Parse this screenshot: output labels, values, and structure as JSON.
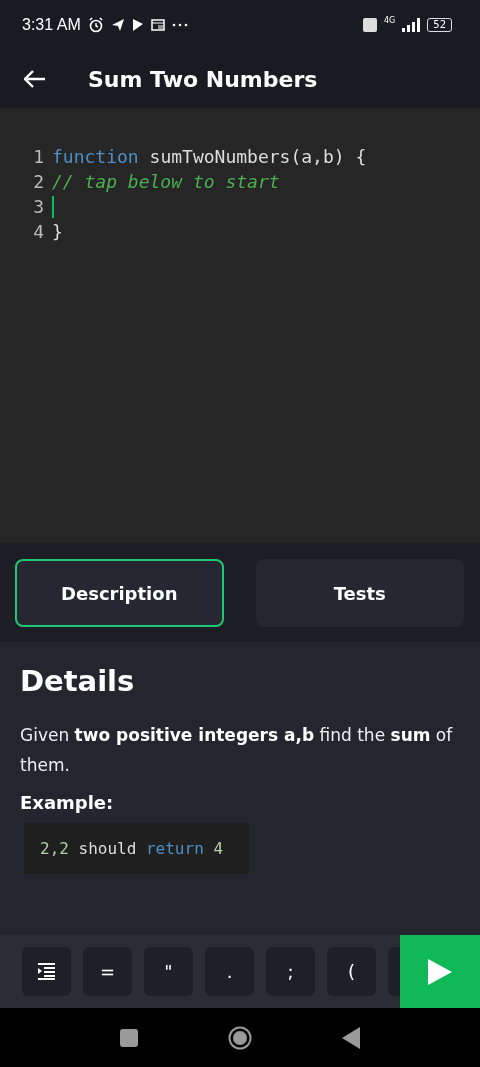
{
  "status_bar": {
    "time": "3:31 AM",
    "network": "4G",
    "battery": "52"
  },
  "header": {
    "title": "Sum Two Numbers"
  },
  "editor": {
    "lines": [
      {
        "number": "1",
        "cursor": false,
        "tokens": [
          {
            "kind": "keyword",
            "text": "function"
          },
          {
            "kind": "plain",
            "text": " sumTwoNumbers(a,b) {"
          }
        ]
      },
      {
        "number": "2",
        "cursor": false,
        "tokens": [
          {
            "kind": "comment",
            "text": "// tap below to start"
          }
        ]
      },
      {
        "number": "3",
        "cursor": true
      },
      {
        "number": "4",
        "cursor": false,
        "tokens": [
          {
            "kind": "plain",
            "text": "}"
          }
        ]
      }
    ]
  },
  "tabs": [
    {
      "label": "Description",
      "selected": true
    },
    {
      "label": "Tests",
      "selected": false
    }
  ],
  "details": {
    "heading": "Details",
    "text": "Given **two positive integers a,b** find the **sum** of them.",
    "example_label": "Example:",
    "example_tokens": [
      {
        "kind": "number",
        "text": "2,2"
      },
      {
        "kind": "plain",
        "text": " should "
      },
      {
        "kind": "keyword",
        "text": "return"
      },
      {
        "kind": "number",
        "text": " 4"
      }
    ]
  },
  "keys": [
    {
      "kind": "indent"
    },
    {
      "kind": "char",
      "label": "="
    },
    {
      "kind": "char",
      "label": "\""
    },
    {
      "kind": "char",
      "label": "."
    },
    {
      "kind": "char",
      "label": ";"
    },
    {
      "kind": "char",
      "label": "("
    }
  ]
}
